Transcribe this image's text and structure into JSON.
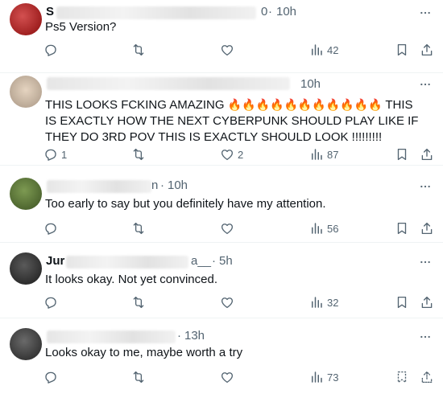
{
  "posts": [
    {
      "handle_fragment": "S",
      "time_fragment": "0",
      "time": "10h",
      "text": "Ps5 Version?",
      "counts": {
        "replies": "",
        "reposts": "",
        "likes": "",
        "views": "42"
      },
      "avatar_color": "#b71c1c"
    },
    {
      "handle_fragment": "",
      "time_fragment": "",
      "time": "10h",
      "text_before_emoji": "THIS LOOKS FCKING AMAZING",
      "emoji": "🔥🔥🔥🔥🔥🔥🔥🔥🔥🔥🔥",
      "text_after_emoji": "THIS IS EXACTLY HOW THE NEXT CYBERPUNK SHOULD PLAY LIKE IF THEY DO 3RD POV THIS IS EXACTLY SHOULD LOOK !!!!!!!!!",
      "counts": {
        "replies": "1",
        "reposts": "",
        "likes": "2",
        "views": "87"
      },
      "avatar_color": "#c8b8a8"
    },
    {
      "handle_fragment": "",
      "time_fragment": "n",
      "time": "10h",
      "text": "Too early to say but you definitely have my attention.",
      "counts": {
        "replies": "",
        "reposts": "",
        "likes": "",
        "views": "56"
      },
      "avatar_color": "#5a7d3a"
    },
    {
      "handle_fragment": "Jur",
      "time_fragment": "a__",
      "time": "5h",
      "text": "It looks okay. Not yet convinced.",
      "counts": {
        "replies": "",
        "reposts": "",
        "likes": "",
        "views": "32"
      },
      "avatar_color": "#2b2b2b"
    },
    {
      "handle_fragment": "",
      "time_fragment": "",
      "time": "13h",
      "text": "Looks okay to me, maybe worth a try",
      "counts": {
        "replies": "",
        "reposts": "",
        "likes": "",
        "views": "73"
      },
      "avatar_color": "#3a3a3a"
    }
  ],
  "colors": {
    "icon": "#536471",
    "text": "#0f1419",
    "divider": "#eff3f4"
  },
  "icons": [
    "more-icon",
    "reply-icon",
    "repost-icon",
    "like-icon",
    "views-icon",
    "bookmark-icon",
    "share-icon"
  ]
}
